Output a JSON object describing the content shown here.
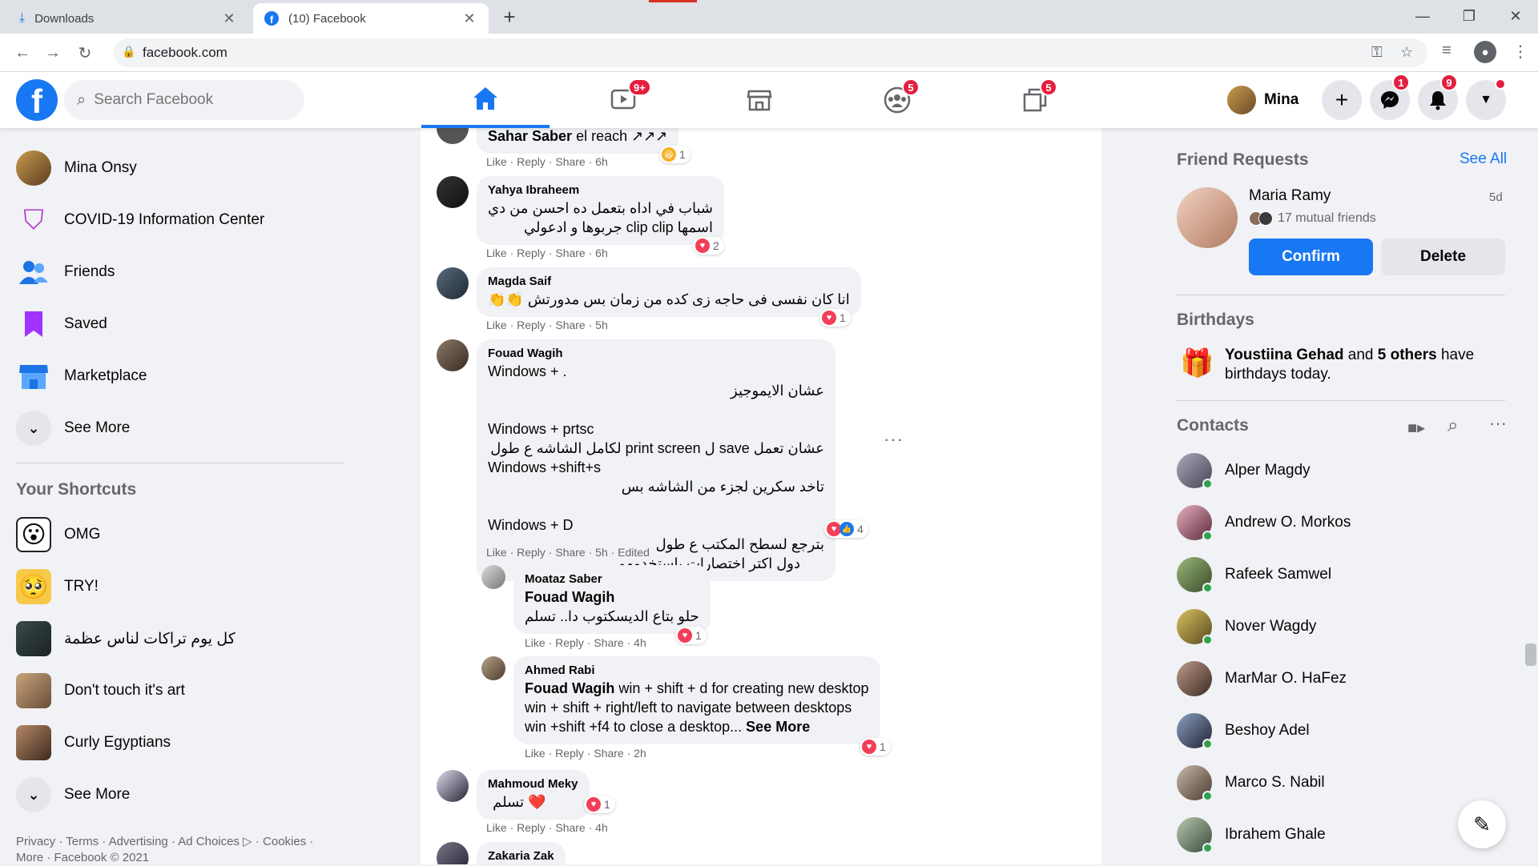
{
  "browser": {
    "tabs": [
      {
        "title": "Downloads",
        "icon": "download-icon"
      },
      {
        "title": "(10) Facebook",
        "icon": "facebook-icon"
      }
    ],
    "url": "facebook.com"
  },
  "header": {
    "search_placeholder": "Search Facebook",
    "watch_badge": "9+",
    "groups_badge": "5",
    "gaming_badge": "5",
    "profile_name": "Mina",
    "messenger_badge": "1",
    "notifications_badge": "9",
    "accent": "#1877f2",
    "badge_color": "#e41e3f"
  },
  "left": {
    "items": [
      {
        "label": "Mina Onsy"
      },
      {
        "label": "COVID-19 Information Center"
      },
      {
        "label": "Friends"
      },
      {
        "label": "Saved"
      },
      {
        "label": "Marketplace"
      },
      {
        "label": "See More"
      }
    ],
    "shortcuts_title": "Your Shortcuts",
    "shortcuts": [
      {
        "label": "OMG"
      },
      {
        "label": "TRY!"
      },
      {
        "label": "كل يوم تراكات لناس عظمة"
      },
      {
        "label": "Don't touch it's art"
      },
      {
        "label": "Curly Egyptians"
      },
      {
        "label": "See More"
      }
    ],
    "footer_line1": "Privacy · Terms · Advertising · Ad Choices ▷ · Cookies ·",
    "footer_line2": "More · Facebook © 2021"
  },
  "comments": [
    {
      "name": "Sahar Saber",
      "text": "el reach ↗↗↗",
      "reaction_count": "1",
      "actions": "Like · Reply · Share · 6h"
    },
    {
      "name": "Yahya Ibraheem",
      "text": "شباب في اداه بتعمل ده احسن من دي\nاسمها clip clip جربوها و ادعولي",
      "reaction_count": "2",
      "actions": "Like · Reply · Share · 6h"
    },
    {
      "name": "Magda Saif",
      "text": "انا كان نفسى فى حاجه زى كده من زمان بس مدورتش 👏👏",
      "reaction_count": "1",
      "actions": "Like · Reply · Share · 5h"
    },
    {
      "name": "Fouad Wagih",
      "lines": [
        "Windows + .",
        "عشان الايموجيز",
        "",
        "Windows + prtsc",
        "عشان تعمل save ل print screen لكامل الشاشه ع طول",
        "Windows +shift+s",
        "تاخد سكرين لجزء من الشاشه بس",
        "",
        "Windows + D",
        "بترجع لسطح المكتب ع طول",
        "دول اكتر اختصارات باستخدمهم"
      ],
      "reaction_count": "4",
      "actions": "Like · Reply · Share · 5h · Edited"
    },
    {
      "name": "Moataz Saber",
      "tag": "Fouad Wagih",
      "text": "حلو بتاع الديسكتوب دا.. تسلم",
      "reaction_count": "1",
      "actions": "Like · Reply · Share · 4h"
    },
    {
      "name": "Ahmed Rabi",
      "tag": "Fouad Wagih",
      "text1": " win + shift + d for creating new desktop",
      "text2": "win + shift + right/left to navigate between desktops",
      "text3": "win +shift +f4 to close a desktop...",
      "see_more": "See More",
      "reaction_count": "1",
      "actions": "Like · Reply · Share · 2h"
    },
    {
      "name": "Mahmoud Meky",
      "text": "❤️ تسلم",
      "reaction_count": "1",
      "actions": "Like · Reply · Share · 4h"
    },
    {
      "name": "Zakaria Zak"
    }
  ],
  "right": {
    "friend_requests_title": "Friend Requests",
    "see_all": "See All",
    "request": {
      "name": "Maria Ramy",
      "mutual": "17 mutual friends",
      "age": "5d",
      "confirm": "Confirm",
      "delete": "Delete"
    },
    "birthdays_title": "Birthdays",
    "birthday_name": "Youstiina Gehad",
    "birthday_and": " and ",
    "birthday_others": "5 others",
    "birthday_tail": " have birthdays today.",
    "contacts_title": "Contacts",
    "contacts": [
      {
        "name": "Alper Magdy"
      },
      {
        "name": "Andrew O. Morkos"
      },
      {
        "name": "Rafeek Samwel"
      },
      {
        "name": "Nover Wagdy"
      },
      {
        "name": "MarMar O. HaFez"
      },
      {
        "name": "Beshoy Adel"
      },
      {
        "name": "Marco S. Nabil"
      },
      {
        "name": "Ibrahem Ghale"
      }
    ]
  }
}
